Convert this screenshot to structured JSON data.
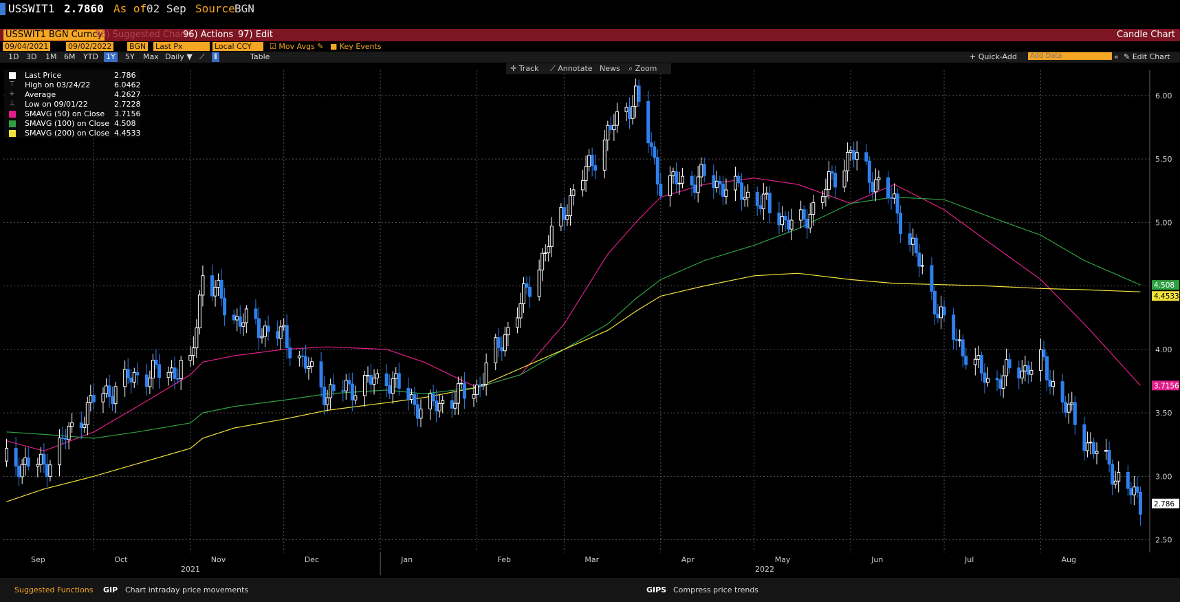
{
  "header": {
    "ticker": "USSWIT1",
    "price": "2.7860",
    "as_of_label": "As of",
    "as_of_date": "02 Sep",
    "source_label": "Source",
    "source": "BGN"
  },
  "toolbar": {
    "security": "USSWIT1 BGN Curncy",
    "suggested_charts": "96) Suggested Charts",
    "actions": "96) Actions",
    "edit": "97) Edit",
    "chart_type": "Candle Chart"
  },
  "settings": {
    "start_date": "09/04/2021",
    "end_date": "09/02/2022",
    "source": "BGN",
    "field": "Last Px",
    "currency": "Local CCY",
    "mov_avgs": "Mov Avgs",
    "key_events": "Key Events"
  },
  "periods": [
    "1D",
    "3D",
    "1M",
    "6M",
    "YTD",
    "1Y",
    "5Y",
    "Max"
  ],
  "selected_period": "1Y",
  "frequency": "Daily",
  "table_label": "Table",
  "right_tools": {
    "quick_add": "+ Quick-Add",
    "add_data_placeholder": "Add Data",
    "edit_chart": "Edit Chart"
  },
  "chart_tools": {
    "track": "Track",
    "annotate": "Annotate",
    "news": "News",
    "zoom": "Zoom"
  },
  "legend": [
    {
      "label": "Last Price",
      "value": "2.786",
      "color": "#ffffff"
    },
    {
      "label": "High on 03/24/22",
      "value": "6.0462"
    },
    {
      "label": "Average",
      "value": "4.2627"
    },
    {
      "label": "Low on 09/01/22",
      "value": "2.7228"
    },
    {
      "label": "SMAVG (50) on Close",
      "value": "3.7156",
      "color": "#e0208a"
    },
    {
      "label": "SMAVG (100) on Close",
      "value": "4.508",
      "color": "#2ea043"
    },
    {
      "label": "SMAVG (200) on Close",
      "value": "4.4533",
      "color": "#f2e23c"
    }
  ],
  "bottom": {
    "suggested_functions": "Suggested Functions",
    "f1_code": "GIP",
    "f1_desc": "Chart intraday price movements",
    "f2_code": "GIPS",
    "f2_desc": "Compress price trends"
  },
  "chart_data": {
    "type": "line",
    "title": "",
    "ylim": [
      2.4,
      6.2
    ],
    "y_ticks": [
      "6.00",
      "5.50",
      "5.00",
      "4.50",
      "4.00",
      "3.50",
      "3.00",
      "2.50"
    ],
    "x_ticks": [
      "Sep",
      "Oct",
      "Nov",
      "Dec",
      "Jan",
      "Feb",
      "Mar",
      "Apr",
      "May",
      "Jun",
      "Jul",
      "Aug"
    ],
    "year_labels": [
      "2021",
      "2022"
    ],
    "colors": {
      "up": "#ffffff",
      "down": "#2f80ed",
      "sma50": "#e0208a",
      "sma100": "#2ea043",
      "sma200": "#f2e23c"
    },
    "x": [
      "2021-09-03",
      "2021-09-15",
      "2021-10-01",
      "2021-10-15",
      "2021-11-01",
      "2021-11-05",
      "2021-11-15",
      "2021-12-01",
      "2021-12-15",
      "2022-01-03",
      "2022-01-15",
      "2022-02-01",
      "2022-02-15",
      "2022-03-01",
      "2022-03-15",
      "2022-03-24",
      "2022-04-01",
      "2022-04-15",
      "2022-05-01",
      "2022-05-15",
      "2022-06-01",
      "2022-06-15",
      "2022-07-01",
      "2022-07-15",
      "2022-08-01",
      "2022-08-15",
      "2022-09-02"
    ],
    "series": [
      {
        "name": "Last Price",
        "values": [
          3.12,
          3.08,
          3.6,
          3.8,
          3.85,
          4.6,
          4.25,
          4.1,
          3.65,
          3.78,
          3.52,
          3.7,
          4.35,
          5.1,
          5.7,
          6.0,
          5.3,
          5.35,
          5.2,
          4.95,
          5.55,
          5.15,
          4.2,
          3.75,
          3.9,
          3.3,
          2.786
        ]
      },
      {
        "name": "SMAVG (50) on Close",
        "values": [
          3.28,
          3.2,
          3.35,
          3.55,
          3.8,
          3.9,
          3.95,
          4.0,
          4.02,
          4.0,
          3.9,
          3.7,
          3.8,
          4.2,
          4.75,
          5.0,
          5.2,
          5.3,
          5.35,
          5.3,
          5.15,
          5.3,
          5.1,
          4.85,
          4.55,
          4.2,
          3.7156
        ]
      },
      {
        "name": "SMAVG (100) on Close",
        "values": [
          3.35,
          3.33,
          3.3,
          3.35,
          3.42,
          3.5,
          3.55,
          3.6,
          3.65,
          3.68,
          3.65,
          3.7,
          3.8,
          4.0,
          4.2,
          4.4,
          4.55,
          4.7,
          4.82,
          4.95,
          5.15,
          5.2,
          5.18,
          5.05,
          4.9,
          4.7,
          4.508
        ]
      },
      {
        "name": "SMAVG (200) on Close",
        "values": [
          2.8,
          2.9,
          3.0,
          3.1,
          3.22,
          3.3,
          3.38,
          3.45,
          3.52,
          3.58,
          3.62,
          3.7,
          3.85,
          4.0,
          4.15,
          4.3,
          4.42,
          4.5,
          4.58,
          4.6,
          4.55,
          4.52,
          4.51,
          4.5,
          4.48,
          4.47,
          4.4533
        ]
      }
    ],
    "last_labels": [
      {
        "name": "SMAVG (100)",
        "value": "4.508"
      },
      {
        "name": "SMAVG (200)",
        "value": "4.4533"
      },
      {
        "name": "SMAVG (50)",
        "value": "3.7156"
      },
      {
        "name": "Last Price",
        "value": "2.786"
      }
    ]
  }
}
